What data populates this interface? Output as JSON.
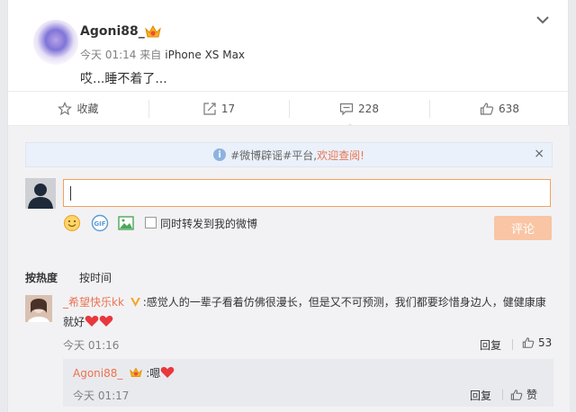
{
  "post": {
    "username": "Agoni88_",
    "time": "今天 01:14",
    "source_prefix": "来自",
    "device": "iPhone XS Max",
    "text": "哎...睡不着了..."
  },
  "actions": {
    "favorite": "收藏",
    "repost_count": "17",
    "comment_count": "228",
    "like_count": "638"
  },
  "notice": {
    "prefix": "#微博辟谣#平台,",
    "link": "欢迎查阅!",
    "close": "×"
  },
  "composer": {
    "input_value": "",
    "repost_label": "同时转发到我的微博",
    "submit_label": "评论"
  },
  "sort": {
    "hot": "按热度",
    "time": "按时间"
  },
  "comment": {
    "username": "_希望快乐kk",
    "colon": ":",
    "text": "感觉人的一辈子看着仿佛很漫长，但是又不可预测，我们都要珍惜身边人，健健康康就好",
    "time": "今天 01:16",
    "reply_label": "回复",
    "like_count": "53"
  },
  "sub_comment": {
    "username": "Agoni88_",
    "colon": ":",
    "text": "嗯",
    "time": "今天 01:17",
    "reply_label": "回复",
    "like_label": "赞"
  },
  "colors": {
    "accent": "#eb7350",
    "submit_disabled": "#f9c5a4",
    "heart": "#e8383d"
  }
}
